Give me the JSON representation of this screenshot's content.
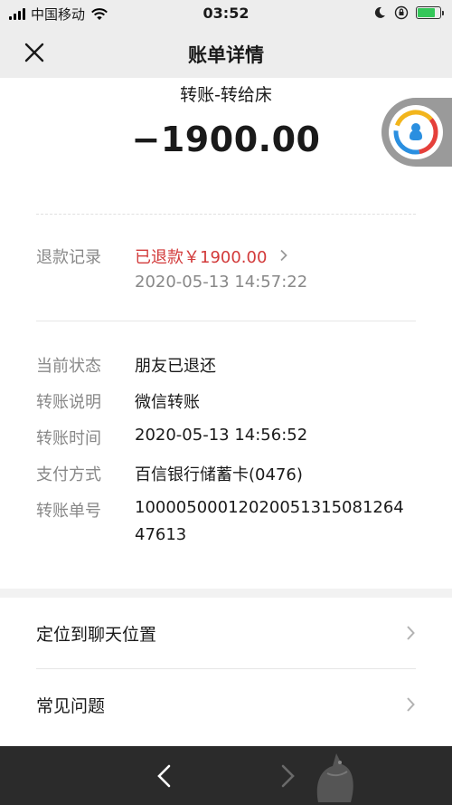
{
  "status_bar": {
    "carrier": "中国移动",
    "time": "03:52"
  },
  "nav": {
    "title": "账单详情"
  },
  "transfer": {
    "title": "转账-转给床",
    "amount": "−1900.00"
  },
  "refund": {
    "label": "退款记录",
    "status": "已退款￥1900.00",
    "time": "2020-05-13 14:57:22"
  },
  "details": [
    {
      "label": "当前状态",
      "value": "朋友已退还"
    },
    {
      "label": "转账说明",
      "value": "微信转账"
    },
    {
      "label": "转账时间",
      "value": "2020-05-13 14:56:52"
    },
    {
      "label": "支付方式",
      "value": "百信银行储蓄卡(0476)"
    },
    {
      "label": "转账单号",
      "value": "10000500012020051315081264",
      "value_line2": "47613"
    }
  ],
  "menu": {
    "locate_chat": "定位到聊天位置",
    "faq": "常见问题"
  },
  "colors": {
    "refund_red": "#d23a3a",
    "nav_bg": "#ededed",
    "bottom_bar_bg": "#2b2b2b"
  }
}
